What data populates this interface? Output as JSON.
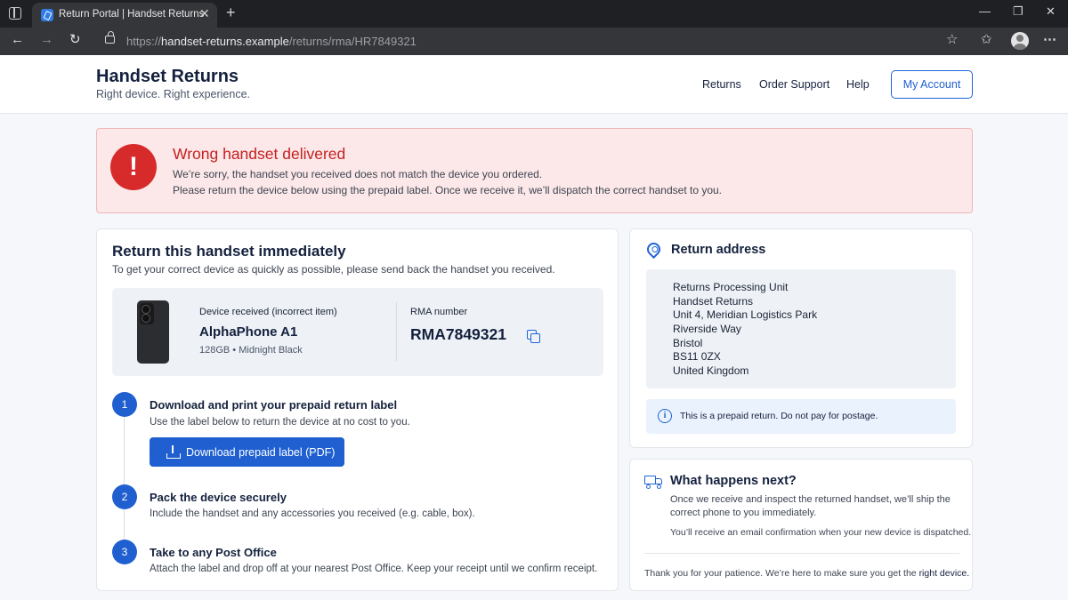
{
  "browser": {
    "tab_title": "Return Portal | Handset Returns",
    "tab_close": "✕",
    "new_tab": "+",
    "url_scheme": "https://",
    "url_host": "handset-returns.example",
    "url_path": "/returns/rma/HR7849321",
    "icons": [
      "sidebar-icon",
      "favicon",
      "close-icon",
      "plus-icon",
      "minimize-icon",
      "maximize-icon",
      "close-window-icon",
      "back-icon",
      "forward-icon",
      "reload-icon",
      "lock-icon",
      "star-icon",
      "favorites-icon",
      "profile-icon",
      "menu-icon"
    ]
  },
  "header": {
    "brand_title": "Handset Returns",
    "brand_tagline": "Right device. Right experience.",
    "nav": [
      "Returns",
      "Order Support",
      "Help"
    ],
    "account_button": "My Account"
  },
  "alert": {
    "icon": "!",
    "title": "Wrong handset delivered",
    "line1": "We’re sorry, the handset you received does not match the device you ordered.",
    "line2": "Please return the device below using the prepaid label. Once we receive it, we’ll dispatch the correct handset to you."
  },
  "main": {
    "title": "Return this handset immediately",
    "subtitle": "To get your correct device as quickly as possible, please send back the handset you received.",
    "device": {
      "label": "Device received (incorrect item)",
      "name": "AlphaPhone A1",
      "spec": "128GB • Midnight Black",
      "rma_label": "RMA number",
      "rma_number": "RMA7849321"
    },
    "steps": [
      {
        "num": "1",
        "title": "Download and print your prepaid return label",
        "desc": "Use the label below to return the device at no cost to you."
      },
      {
        "num": "2",
        "title": "Pack the device securely",
        "desc": "Include the handset and any accessories you received (e.g. cable, box)."
      },
      {
        "num": "3",
        "title": "Take to any Post Office",
        "desc": "Attach the label and drop off at your nearest Post Office. Keep your receipt until we confirm receipt."
      }
    ],
    "download_button": "Download prepaid label (PDF)"
  },
  "return_address": {
    "title": "Return address",
    "lines": [
      "Returns Processing Unit",
      "Handset Returns",
      "Unit 4, Meridian Logistics Park",
      "Riverside Way",
      "Bristol",
      "BS11 0ZX",
      "United Kingdom"
    ],
    "info_icon": "i",
    "info": "This is a prepaid return. Do not pay for postage."
  },
  "next": {
    "title": "What happens next?",
    "line1": "Once we receive and inspect the returned handset, we’ll ship the",
    "line2": "correct phone to you immediately.",
    "line3": "You’ll receive an email confirmation when your new device is dispatched.",
    "thanks_prefix": "Thank you for your patience. We’re here to make sure you get the ",
    "thanks_strong": "right device."
  },
  "colors": {
    "accent": "#1f5fd0",
    "alert_bg": "#fce8e8",
    "alert_red": "#d72b2b",
    "page_bg": "#f5f7fa"
  }
}
